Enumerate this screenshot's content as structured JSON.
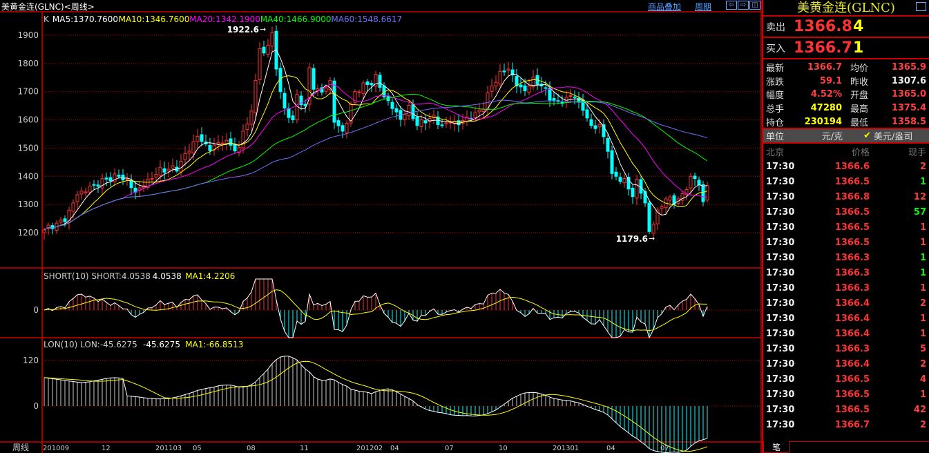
{
  "header": {
    "title": "美黄金连(GLNC)<周线>",
    "overlay_link": "商品叠加",
    "period_link": "周期",
    "nav_left_icon": "arrow-left",
    "nav_right_icon": "arrow-right",
    "layout_icon": "split-panel"
  },
  "colors": {
    "up": "#ff3232",
    "down": "#00ffff",
    "ma5": "#ffffff",
    "ma10": "#ffff00",
    "ma20": "#ff00ff",
    "ma40": "#00ff00",
    "ma60": "#7070ff",
    "grid": "#c00000"
  },
  "main_panel": {
    "legend": [
      {
        "text": "K",
        "color": "#cccccc"
      },
      {
        "text": "MA5:1370.7600",
        "color": "#ffffff"
      },
      {
        "text": "MA10:1346.7600",
        "color": "#ffff00"
      },
      {
        "text": "MA20:1342.1900",
        "color": "#ff00ff"
      },
      {
        "text": "MA40:1466.9000",
        "color": "#00ff00"
      },
      {
        "text": "MA60:1548.6617",
        "color": "#7070ff"
      }
    ],
    "y_ticks": [
      1900,
      1800,
      1700,
      1600,
      1500,
      1400,
      1300,
      1200
    ],
    "high_label": "1922.6",
    "low_label": "1179.6"
  },
  "short_panel": {
    "legend": [
      {
        "text": "SHORT(10) SHORT:4.0538",
        "color": "#cccccc"
      },
      {
        "text": "4.0538",
        "color": "#ffffff"
      },
      {
        "text": "MA1:4.2206",
        "color": "#ffff00"
      }
    ],
    "y_ticks": [
      0
    ]
  },
  "lon_panel": {
    "legend": [
      {
        "text": "LON(10) LON:-45.6275",
        "color": "#cccccc"
      },
      {
        "text": "-45.6275",
        "color": "#ffffff"
      },
      {
        "text": "MA1:-66.8513",
        "color": "#ffff00"
      }
    ],
    "y_ticks": [
      120,
      0
    ]
  },
  "x_axis": {
    "label": "周线",
    "ticks": [
      "201009",
      "12",
      "201103",
      "05",
      "08",
      "11",
      "201202",
      "04",
      "07",
      "10",
      "201301",
      "04",
      "07"
    ]
  },
  "chart_data": {
    "type": "candlestick",
    "series_keypoints_week_close": [
      [
        0,
        1210
      ],
      [
        5,
        1250
      ],
      [
        8,
        1340
      ],
      [
        12,
        1370
      ],
      [
        15,
        1390
      ],
      [
        18,
        1400
      ],
      [
        20,
        1380
      ],
      [
        22,
        1340
      ],
      [
        25,
        1380
      ],
      [
        28,
        1420
      ],
      [
        32,
        1430
      ],
      [
        35,
        1500
      ],
      [
        37,
        1545
      ],
      [
        40,
        1500
      ],
      [
        43,
        1530
      ],
      [
        45,
        1510
      ],
      [
        47,
        1490
      ],
      [
        48,
        1560
      ],
      [
        50,
        1620
      ],
      [
        51,
        1740
      ],
      [
        52,
        1850
      ],
      [
        53,
        1830
      ],
      [
        55,
        1900
      ],
      [
        56,
        1780
      ],
      [
        57,
        1700
      ],
      [
        58,
        1630
      ],
      [
        60,
        1600
      ],
      [
        61,
        1680
      ],
      [
        63,
        1650
      ],
      [
        64,
        1780
      ],
      [
        65,
        1720
      ],
      [
        67,
        1700
      ],
      [
        69,
        1740
      ],
      [
        70,
        1600
      ],
      [
        72,
        1560
      ],
      [
        73,
        1600
      ],
      [
        75,
        1700
      ],
      [
        77,
        1720
      ],
      [
        79,
        1730
      ],
      [
        80,
        1750
      ],
      [
        82,
        1680
      ],
      [
        84,
        1640
      ],
      [
        86,
        1600
      ],
      [
        88,
        1640
      ],
      [
        90,
        1580
      ],
      [
        92,
        1600
      ],
      [
        94,
        1610
      ],
      [
        96,
        1580
      ],
      [
        98,
        1600
      ],
      [
        100,
        1590
      ],
      [
        102,
        1610
      ],
      [
        104,
        1620
      ],
      [
        106,
        1650
      ],
      [
        108,
        1720
      ],
      [
        110,
        1760
      ],
      [
        112,
        1780
      ],
      [
        114,
        1720
      ],
      [
        116,
        1700
      ],
      [
        118,
        1740
      ],
      [
        120,
        1720
      ],
      [
        122,
        1680
      ],
      [
        124,
        1660
      ],
      [
        126,
        1680
      ],
      [
        128,
        1690
      ],
      [
        130,
        1640
      ],
      [
        132,
        1580
      ],
      [
        134,
        1580
      ],
      [
        136,
        1500
      ],
      [
        137,
        1400
      ],
      [
        138,
        1400
      ],
      [
        140,
        1380
      ],
      [
        142,
        1330
      ],
      [
        143,
        1380
      ],
      [
        145,
        1300
      ],
      [
        146,
        1200
      ],
      [
        147,
        1230
      ],
      [
        148,
        1270
      ],
      [
        150,
        1320
      ],
      [
        152,
        1310
      ],
      [
        154,
        1330
      ],
      [
        156,
        1400
      ],
      [
        158,
        1380
      ],
      [
        159,
        1310
      ],
      [
        160,
        1366.7
      ]
    ],
    "ylim": [
      1100,
      1960
    ],
    "period": "weekly"
  },
  "side": {
    "title": "美黄金连(GLNC)",
    "sell": {
      "label": "卖出",
      "price": "1366.8",
      "volume": "4"
    },
    "buy": {
      "label": "买入",
      "price": "1366.7",
      "volume": "1"
    },
    "stats": [
      {
        "k": "最新",
        "v": "1366.7",
        "vc": "#ff4040",
        "k2": "均价",
        "v2": "1365.9",
        "v2c": "#ff4040"
      },
      {
        "k": "涨跌",
        "v": "59.1",
        "vc": "#ff4040",
        "k2": "昨收",
        "v2": "1307.6",
        "v2c": "#eeeeee"
      },
      {
        "k": "幅度",
        "v": "4.52%",
        "vc": "#ff4040",
        "k2": "开盘",
        "v2": "1365.0",
        "v2c": "#ff4040"
      },
      {
        "k": "总手",
        "v": "47280",
        "vc": "#ffff00",
        "k2": "最高",
        "v2": "1375.4",
        "v2c": "#ff4040"
      },
      {
        "k": "持仓",
        "v": "230194",
        "vc": "#ffff00",
        "k2": "最低",
        "v2": "1358.5",
        "v2c": "#ff4040"
      }
    ],
    "unit": {
      "label": "单位",
      "option1": "元/克",
      "option2": "美元/盎司",
      "checked": "✔"
    },
    "trade_header": {
      "time": "北京",
      "price": "价格",
      "vol": "现手"
    },
    "trades": [
      {
        "t": "17:30",
        "p": "1366.6",
        "n": "2",
        "c": "#ff4040"
      },
      {
        "t": "17:30",
        "p": "1366.5",
        "n": "1",
        "c": "#00ff00"
      },
      {
        "t": "17:30",
        "p": "1366.8",
        "n": "12",
        "c": "#ff4040"
      },
      {
        "t": "17:30",
        "p": "1366.5",
        "n": "57",
        "c": "#00ff00"
      },
      {
        "t": "17:30",
        "p": "1366.5",
        "n": "1",
        "c": "#ff4040"
      },
      {
        "t": "17:30",
        "p": "1366.5",
        "n": "1",
        "c": "#ff4040"
      },
      {
        "t": "17:30",
        "p": "1366.3",
        "n": "1",
        "c": "#00ff00"
      },
      {
        "t": "17:30",
        "p": "1366.3",
        "n": "1",
        "c": "#00ff00"
      },
      {
        "t": "17:30",
        "p": "1366.3",
        "n": "1",
        "c": "#ff4040"
      },
      {
        "t": "17:30",
        "p": "1366.4",
        "n": "2",
        "c": "#ff4040"
      },
      {
        "t": "17:30",
        "p": "1366.4",
        "n": "1",
        "c": "#ff4040"
      },
      {
        "t": "17:30",
        "p": "1366.4",
        "n": "1",
        "c": "#ff4040"
      },
      {
        "t": "17:30",
        "p": "1366.3",
        "n": "5",
        "c": "#ff4040"
      },
      {
        "t": "17:30",
        "p": "1366.4",
        "n": "2",
        "c": "#ff4040"
      },
      {
        "t": "17:30",
        "p": "1366.5",
        "n": "4",
        "c": "#ff4040"
      },
      {
        "t": "17:30",
        "p": "1366.5",
        "n": "1",
        "c": "#ff4040"
      },
      {
        "t": "17:30",
        "p": "1366.5",
        "n": "42",
        "c": "#ff4040"
      },
      {
        "t": "17:30",
        "p": "1366.7",
        "n": "2",
        "c": "#ff4040"
      }
    ],
    "tab": "笔"
  }
}
